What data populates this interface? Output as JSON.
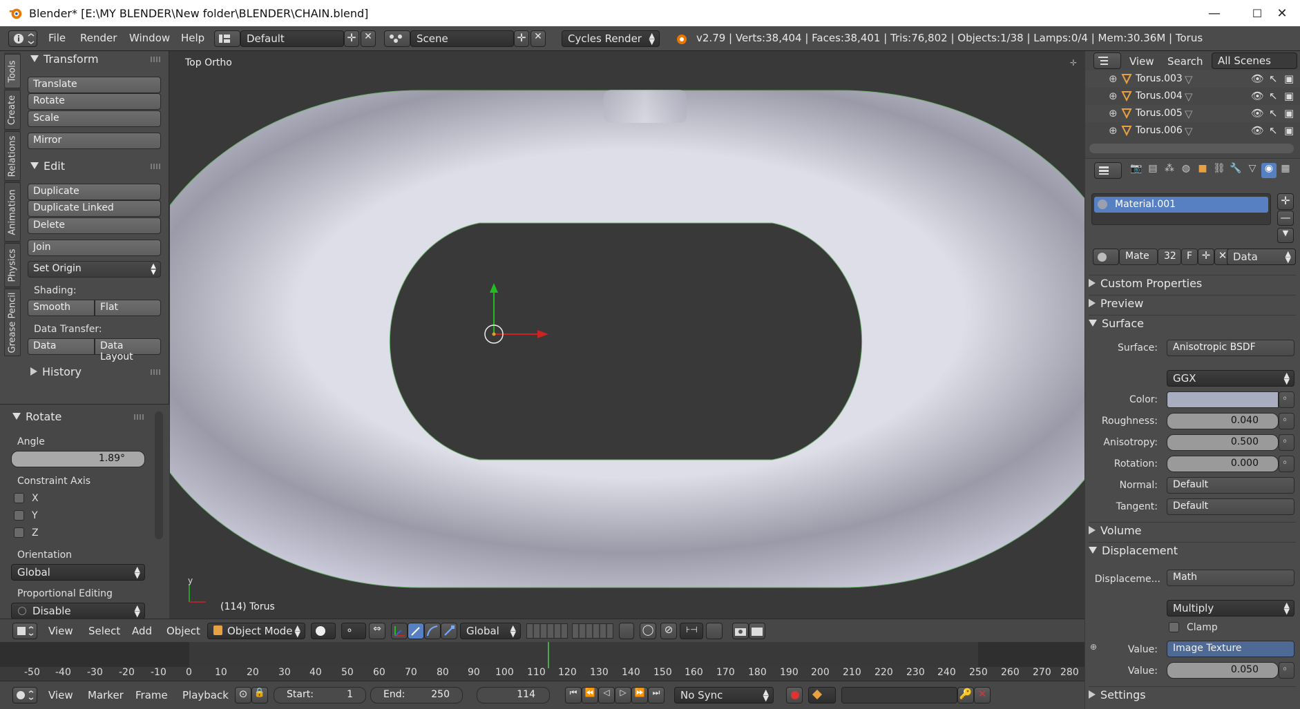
{
  "titlebar": {
    "title": "Blender* [E:\\MY BLENDER\\New folder\\BLENDER\\CHAIN.blend]",
    "minimize": "—",
    "maximize": "☐",
    "close": "✕"
  },
  "info": {
    "menus": [
      "File",
      "Render",
      "Window",
      "Help"
    ],
    "layout": "Default",
    "scene": "Scene",
    "engine": "Cycles Render",
    "stats": "v2.79 | Verts:38,404 | Faces:38,401 | Tris:76,802 | Objects:1/38 | Lamps:0/4 | Mem:30.36M | Torus"
  },
  "tabs": [
    "Tools",
    "Create",
    "Relations",
    "Animation",
    "Physics",
    "Grease Pencil"
  ],
  "tools": {
    "transform_title": "Transform",
    "translate": "Translate",
    "rotate": "Rotate",
    "scale": "Scale",
    "mirror": "Mirror",
    "edit_title": "Edit",
    "duplicate": "Duplicate",
    "duplicate_linked": "Duplicate Linked",
    "delete": "Delete",
    "join": "Join",
    "set_origin": "Set Origin",
    "shading_label": "Shading:",
    "smooth": "Smooth",
    "flat": "Flat",
    "data_transfer_label": "Data Transfer:",
    "data": "Data",
    "data_layout": "Data Layout",
    "history_title": "History"
  },
  "operator": {
    "title": "Rotate",
    "angle_label": "Angle",
    "angle_value": "1.89°",
    "constraint_label": "Constraint Axis",
    "x": "X",
    "y": "Y",
    "z": "Z",
    "orientation_label": "Orientation",
    "orientation": "Global",
    "prop_edit_label": "Proportional Editing",
    "prop_edit": "Disable"
  },
  "viewport": {
    "view_name": "Top Ortho",
    "object_label": "(114) Torus",
    "axis_y": "y"
  },
  "header3d": {
    "view": "View",
    "select": "Select",
    "add": "Add",
    "object": "Object",
    "mode": "Object Mode",
    "orientation": "Global"
  },
  "timeline": {
    "ticks": [
      "-50",
      "-40",
      "-30",
      "-20",
      "-10",
      "0",
      "10",
      "20",
      "30",
      "40",
      "50",
      "60",
      "70",
      "80",
      "90",
      "100",
      "110",
      "120",
      "130",
      "140",
      "150",
      "160",
      "170",
      "180",
      "190",
      "200",
      "210",
      "220",
      "230",
      "240",
      "250",
      "260",
      "270",
      "280"
    ],
    "current_frame": 114
  },
  "tlheader": {
    "view": "View",
    "marker": "Marker",
    "frame": "Frame",
    "playback": "Playback",
    "start_label": "Start:",
    "start": "1",
    "end_label": "End:",
    "end": "250",
    "current": "114",
    "sync": "No Sync"
  },
  "outliner": {
    "view": "View",
    "search": "Search",
    "scenes": "All Scenes",
    "items": [
      "Torus.003",
      "Torus.004",
      "Torus.005",
      "Torus.006"
    ]
  },
  "props": {
    "material": "Material.001",
    "mate": "Mate",
    "users": "32",
    "fake": "F",
    "link": "Data",
    "custom_props": "Custom Properties",
    "preview": "Preview",
    "surface_title": "Surface",
    "surface_label": "Surface:",
    "surface": "Anisotropic BSDF",
    "distribution": "GGX",
    "color_label": "Color:",
    "roughness_label": "Roughness:",
    "roughness": "0.040",
    "anisotropy_label": "Anisotropy:",
    "anisotropy": "0.500",
    "rotation_label": "Rotation:",
    "rotation": "0.000",
    "normal_label": "Normal:",
    "normal": "Default",
    "tangent_label": "Tangent:",
    "tangent": "Default",
    "volume": "Volume",
    "displacement_title": "Displacement",
    "displacement_label": "Displaceme...",
    "displacement": "Math",
    "operation": "Multiply",
    "clamp": "Clamp",
    "value1_label": "Value:",
    "value1": "Image Texture",
    "value2_label": "Value:",
    "value2": "0.050",
    "settings": "Settings"
  },
  "colors": {
    "accent": "#5680c2",
    "x_axis": "#cc2222",
    "y_axis": "#22bb22",
    "current_frame": "#4fa84f"
  }
}
